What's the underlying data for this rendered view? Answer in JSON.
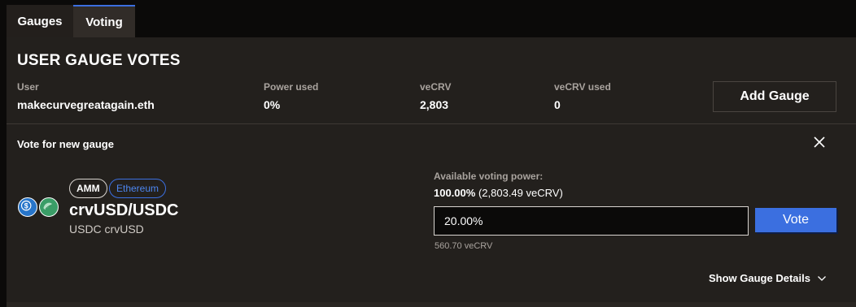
{
  "tabs": [
    {
      "label": "Gauges",
      "active": false
    },
    {
      "label": "Voting",
      "active": true
    }
  ],
  "title": "USER GAUGE VOTES",
  "stats": {
    "user": {
      "label": "User",
      "value": "makecurvegreatagain.eth"
    },
    "power_used": {
      "label": "Power used",
      "value": "0%"
    },
    "vecrv": {
      "label": "veCRV",
      "value": "2,803"
    },
    "vecrv_used": {
      "label": "veCRV used",
      "value": "0"
    }
  },
  "add_gauge_label": "Add Gauge",
  "vote_section": {
    "heading": "Vote for new gauge",
    "close_icon": "close-icon",
    "pool": {
      "badges": [
        "AMM",
        "Ethereum"
      ],
      "name": "crvUSD/USDC",
      "subtitle": "USDC crvUSD",
      "token_icons": [
        "usdc-token-icon",
        "crvusd-token-icon"
      ]
    },
    "available_label": "Available voting power:",
    "available_percent": "100.00%",
    "available_amount": "(2,803.49 veCRV)",
    "input_value": "20.00%",
    "vote_button": "Vote",
    "vecrv_amount": "560.70 veCRV",
    "show_details": "Show Gauge Details"
  },
  "colors": {
    "accent": "#3b6fe0",
    "panel": "#23201d",
    "background": "#0b0a09"
  }
}
